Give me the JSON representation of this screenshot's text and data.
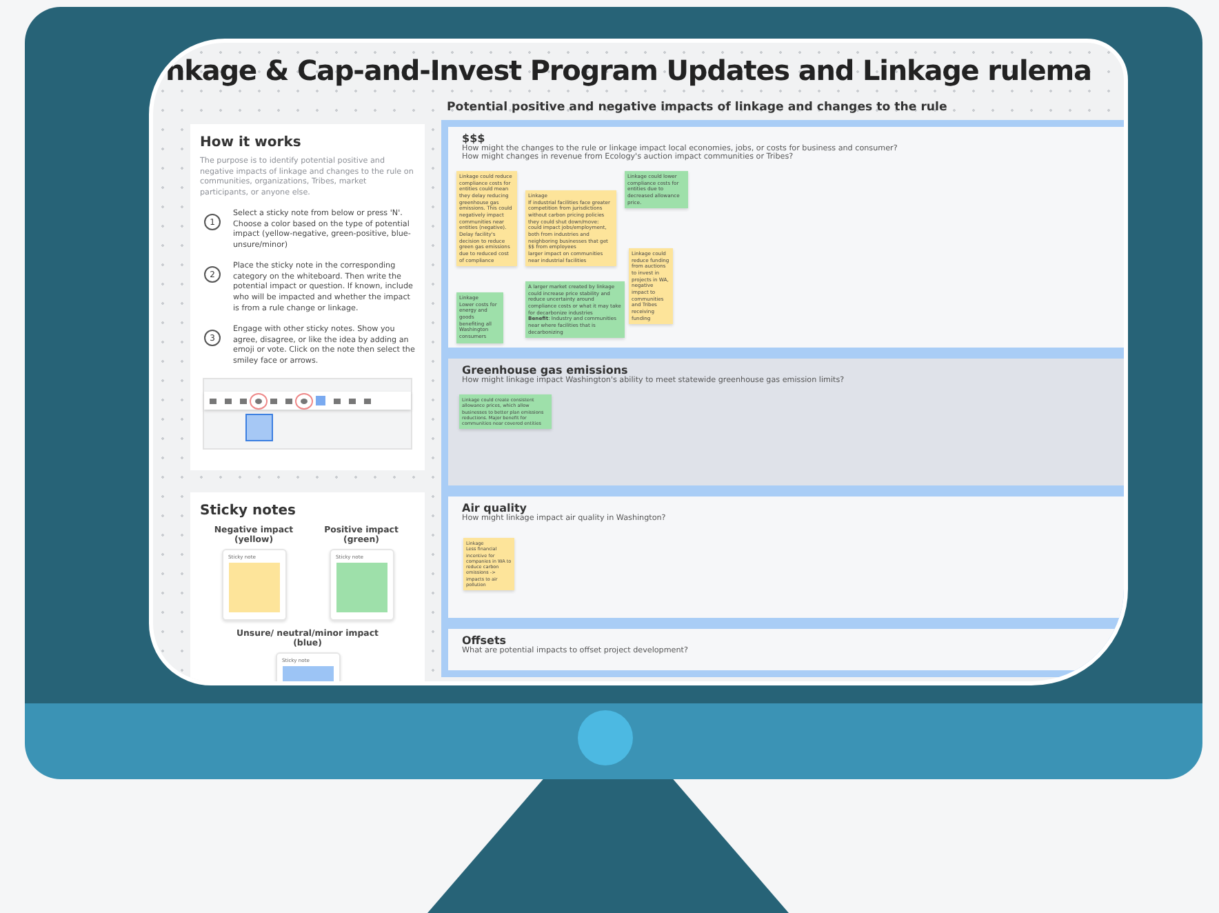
{
  "screen_title": "nkage & Cap-and-Invest Program Updates and Linkage rulema",
  "sidebar": {
    "how_it_works": {
      "title": "How it works",
      "intro": "The purpose is to identify potential positive and negative impacts of linkage and changes to the rule on communities, organizations, Tribes, market participants, or anyone else.",
      "steps": [
        {
          "number": "1",
          "text": "Select a sticky note from below or press 'N'. Choose a color based on the type of potential impact (yellow-negative, green-positive, blue-unsure/minor)"
        },
        {
          "number": "2",
          "text": "Place the sticky note in the corresponding category on the whiteboard. Then write the potential impact or question. If known, include who will be impacted and whether the impact is from a rule change or linkage."
        },
        {
          "number": "3",
          "text": "Engage with other sticky notes. Show you agree, disagree, or like the idea by adding an emoji or vote. Click on the note then select the smiley face or arrows."
        }
      ]
    },
    "sticky_notes": {
      "title": "Sticky notes",
      "types": [
        {
          "label": "Negative impact (yellow)",
          "sample_label": "Sticky note",
          "color": "#fde49a"
        },
        {
          "label": "Positive impact (green)",
          "sample_label": "Sticky note",
          "color": "#9ee0aa"
        },
        {
          "label": "Unsure/ neutral/minor impact (blue)",
          "sample_label": "Sticky note",
          "color": "#9cc4f5"
        }
      ]
    }
  },
  "board": {
    "heading": "Potential positive and negative impacts of linkage and changes to the rule",
    "sections": [
      {
        "title": "$$$",
        "shaded": false,
        "questions": [
          "How might the changes to the rule or linkage impact local economies, jobs, or costs for business and consumer?",
          "How might changes in revenue from Ecology's auction impact communities or Tribes?"
        ],
        "notes": [
          {
            "text": "Linkage could reduce compliance costs for entities could mean they delay reducing greenhouse gas emissions. This could negatively impact communities near entities (negative). Delay facility's decision to reduce green gas emissions due to reduced cost of compliance",
            "color": "#fde49a"
          },
          {
            "text": "Linkage\nIf industrial facilities face greater competition from jurisdictions without carbon pricing policies they could shut down/move: could impact jobs/employment, both from industries and neighboring businesses that get $$ from employees\nlarger impact on communities near industrial facilities",
            "color": "#fde49a"
          },
          {
            "text": "Linkage could lower compliance costs for entities due to decreased allowance price.",
            "color": "#9ee0aa"
          },
          {
            "text": "Linkage\nLower costs for energy and goods benefiting all Washington consumers",
            "color": "#9ee0aa"
          },
          {
            "text": "A larger market created by linkage could increase price stability and reduce uncertainty around compliance costs or what it may take for decarbonize industries\n**Benefit**: Industry and communities near where facilities that is decarbonizing",
            "color": "#9ee0aa"
          },
          {
            "text": "Linkage could reduce funding from auctions to invest in projects in WA, negative impact to communities and Tribes receiving funding",
            "color": "#fde49a"
          }
        ]
      },
      {
        "title": "Greenhouse gas emissions",
        "shaded": true,
        "questions": [
          "How might linkage impact Washington's ability to meet statewide greenhouse gas emission limits?"
        ],
        "notes": [
          {
            "text": "Linkage could create consistent allowance prices, which allow businesses to better plan emissions reductions. Major benefit for communities near covered entities",
            "color": "#9ee0aa"
          }
        ]
      },
      {
        "title": "Air quality",
        "shaded": false,
        "questions": [
          "How might linkage impact air quality in Washington?"
        ],
        "notes": [
          {
            "text": "Linkage\nLess financial incentive for companies in WA to reduce carbon emissions -> impacts to air pollution",
            "color": "#fde49a"
          }
        ]
      },
      {
        "title": "Offsets",
        "shaded": false,
        "questions": [
          "What are potential impacts to offset project development?"
        ]
      }
    ]
  }
}
